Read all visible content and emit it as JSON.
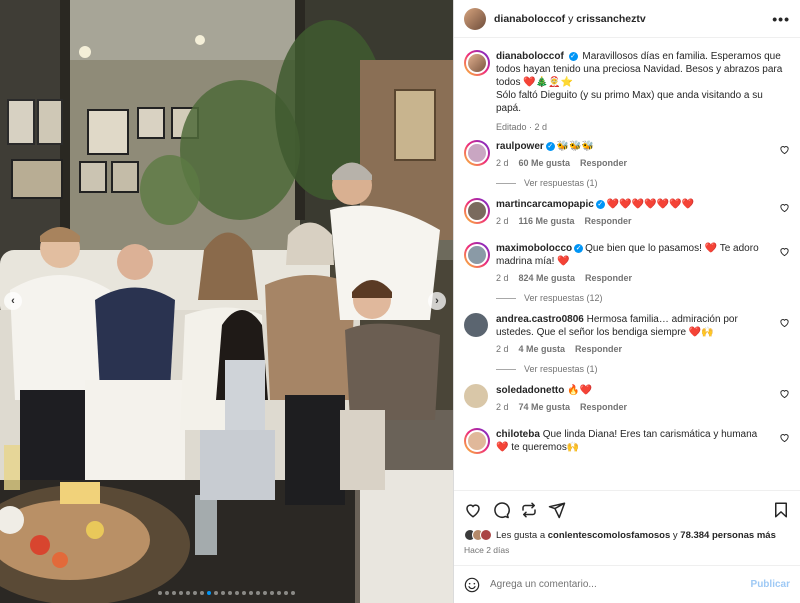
{
  "header": {
    "user1": "dianaboloccof",
    "separator": "y",
    "user2": "crissancheztv",
    "more_label": "•••"
  },
  "photo": {
    "prev_label": "‹",
    "next_label": "›",
    "slide_count": 20,
    "active_slide": 7
  },
  "caption": {
    "username": "dianaboloccof",
    "text_line1": "Maravillosos días en familia. Esperamos que todos hayan tenido una preciosa Navidad. Besos y abrazos para todos ❤️🎄🤶⭐",
    "text_line2": "Sólo faltó Dieguito (y su primo Max) que anda visitando a su papá.",
    "edited": "Editado · 2 d"
  },
  "comments": [
    {
      "username": "raulpower",
      "verified": true,
      "text": "🐝🐝🐝",
      "time": "2 d",
      "likes": "60 Me gusta",
      "reply": "Responder",
      "replies": "Ver respuestas (1)",
      "avatar_color": "#c9a6c2"
    },
    {
      "username": "martincarcamopapic",
      "verified": true,
      "text": "❤️❤️❤️❤️❤️❤️❤️",
      "time": "2 d",
      "likes": "116 Me gusta",
      "reply": "Responder",
      "replies": "",
      "avatar_color": "#7a6a5e"
    },
    {
      "username": "maximobolocco",
      "verified": true,
      "text": "Que bien que lo pasamos! ❤️ Te adoro madrina mía! ❤️",
      "time": "2 d",
      "likes": "824 Me gusta",
      "reply": "Responder",
      "replies": "Ver respuestas (12)",
      "avatar_color": "#8a9aa6"
    },
    {
      "username": "andrea.castro0806",
      "verified": false,
      "text": "Hermosa familia… admiración por ustedes. Que el señor los bendiga siempre ❤️🙌",
      "time": "2 d",
      "likes": "4 Me gusta",
      "reply": "Responder",
      "replies": "Ver respuestas (1)",
      "avatar_color": "#5b6570"
    },
    {
      "username": "soledadonetto",
      "verified": false,
      "text": "🔥❤️",
      "time": "2 d",
      "likes": "74 Me gusta",
      "reply": "Responder",
      "replies": "",
      "avatar_color": "#d9c7a8"
    },
    {
      "username": "chiloteba",
      "verified": false,
      "text": "Que linda Diana! Eres tan carismática y humana ❤️ te queremos🙌",
      "time": "",
      "likes": "",
      "reply": "",
      "replies": "",
      "avatar_color": "#e0b89a"
    }
  ],
  "likes": {
    "prefix": "Les gusta a",
    "user": "conlentescomolosfamosos",
    "connector": "y",
    "count": "78.384 personas más"
  },
  "posted": "Hace 2 días",
  "add_comment": {
    "placeholder": "Agrega un comentario...",
    "publish_label": "Publicar"
  },
  "colors": {
    "verified": "#0095f6",
    "muted": "#737373",
    "publish": "#9ec9f5",
    "heart": "#ed4956"
  },
  "icons": [
    "heart-icon",
    "comment-icon",
    "repost-icon",
    "share-icon",
    "bookmark-icon",
    "emoji-icon",
    "more-icon"
  ]
}
